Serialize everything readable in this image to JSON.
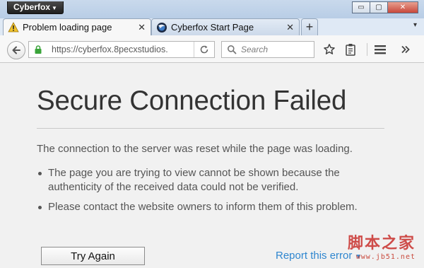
{
  "app": {
    "menu_label": "Cyberfox"
  },
  "window_controls": {
    "minimize_glyph": "▭",
    "maximize_glyph": "▢",
    "close_glyph": "✕"
  },
  "tabs": [
    {
      "label": "Problem loading page",
      "icon": "warning-icon",
      "active": true,
      "close_glyph": "✕"
    },
    {
      "label": "Cyberfox Start Page",
      "icon": "cyberfox-logo-icon",
      "active": false,
      "close_glyph": "✕"
    }
  ],
  "new_tab_glyph": "+",
  "tab_overflow_glyph": "▾",
  "navbar": {
    "url": "https://cyberfox.8pecxstudios.",
    "search_placeholder": "Search"
  },
  "error": {
    "title": "Secure Connection Failed",
    "description": "The connection to the server was reset while the page was loading.",
    "bullets": [
      "The page you are trying to view cannot be shown because the authenticity of the received data could not be verified.",
      "Please contact the website owners to inform them of this problem."
    ],
    "try_again_label": "Try Again",
    "report_label": "Report this error"
  },
  "watermark": {
    "main": "脚本之家",
    "sub": "www.jb51.net"
  },
  "colors": {
    "link": "#2f86cf",
    "warning": "#f0c22b",
    "lock": "#3aa43a",
    "watermark": "#c9302c"
  }
}
